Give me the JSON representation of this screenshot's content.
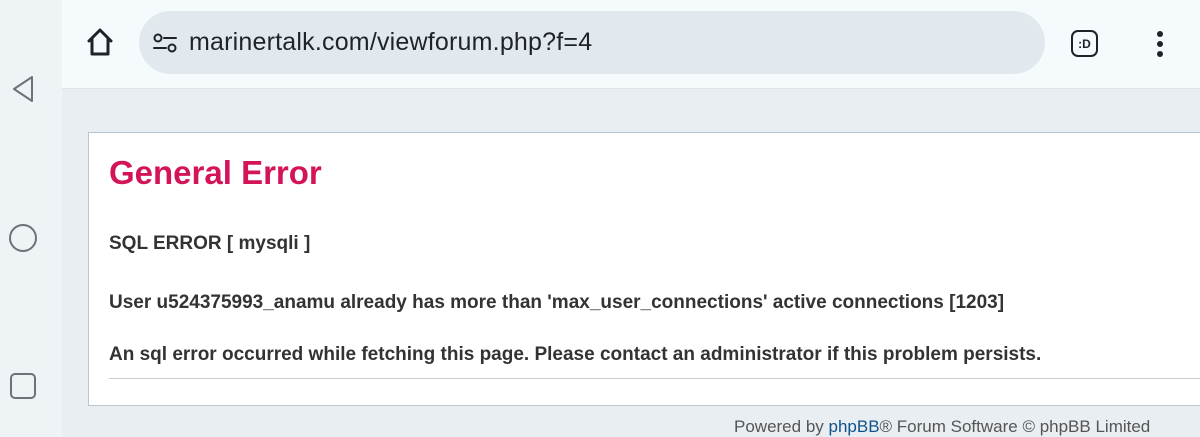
{
  "browser": {
    "url": "marinertalk.com/viewforum.php?f=4",
    "tabs_label": ":D"
  },
  "navigation": {
    "back_icon": "triangle-back-icon",
    "home_icon": "circle-home-icon",
    "recents_icon": "square-recents-icon"
  },
  "error": {
    "title": "General Error",
    "sql_error": "SQL ERROR [ mysqli ]",
    "message": "User u524375993_anamu already has more than 'max_user_connections' active connections [1203]",
    "notice": "An sql error occurred while fetching this page. Please contact an administrator if this problem persists."
  },
  "footer": {
    "prefix": "Powered by ",
    "link": "phpBB",
    "suffix": "® Forum Software © phpBB Limited"
  },
  "colors": {
    "title": "#d3145a",
    "link": "#105289",
    "text": "#333333"
  }
}
